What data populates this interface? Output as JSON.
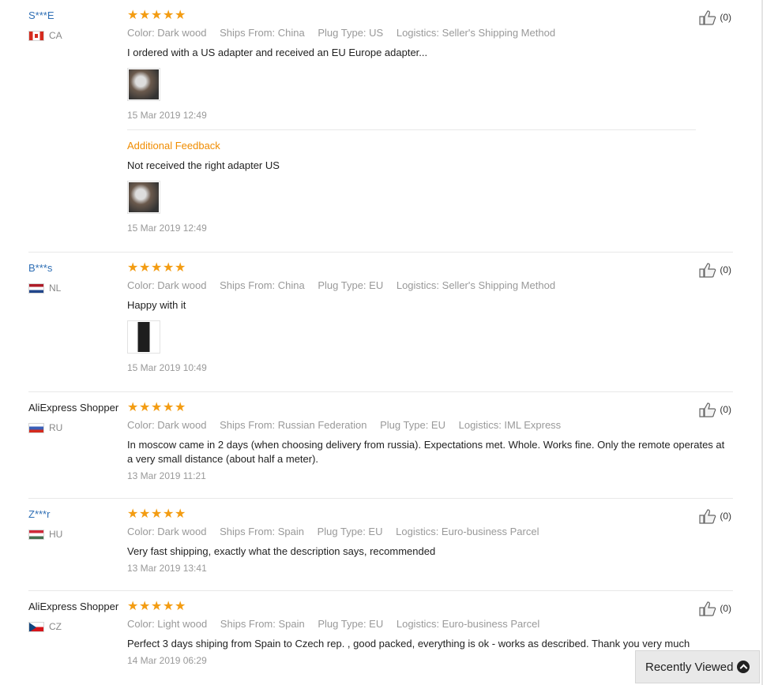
{
  "reviews": [
    {
      "user": "S***E",
      "user_is_link": true,
      "country": "CA",
      "flag": "flag-ca",
      "stars": 5,
      "attrs": [
        "Color: Dark wood",
        "Ships From: China",
        "Plug Type: US",
        "Logistics: Seller's Shipping Method"
      ],
      "text": "I ordered with a US adapter and received an EU Europe adapter...",
      "has_image": true,
      "date": "15 Mar 2019 12:49",
      "additional_title": "Additional Feedback",
      "additional_text": "Not received the right adapter US",
      "additional_date": "15 Mar 2019 12:49",
      "likes": "(0)"
    },
    {
      "user": "B***s",
      "user_is_link": true,
      "country": "NL",
      "flag": "flag-nl",
      "stars": 5,
      "attrs": [
        "Color: Dark wood",
        "Ships From: China",
        "Plug Type: EU",
        "Logistics: Seller's Shipping Method"
      ],
      "text": "Happy with it",
      "has_image": true,
      "date": "15 Mar 2019 10:49",
      "likes": "(0)"
    },
    {
      "user": "AliExpress Shopper",
      "user_is_link": false,
      "country": "RU",
      "flag": "flag-ru",
      "stars": 5,
      "attrs": [
        "Color: Dark wood",
        "Ships From: Russian Federation",
        "Plug Type: EU",
        "Logistics: IML Express"
      ],
      "text": "In moscow came in 2 days (when choosing delivery from russia). Expectations met. Whole. Works fine. Only the remote operates at a very small distance (about half a meter).",
      "has_image": false,
      "date": "13 Mar 2019 11:21",
      "likes": "(0)"
    },
    {
      "user": "Z***r",
      "user_is_link": true,
      "country": "HU",
      "flag": "flag-hu",
      "stars": 5,
      "attrs": [
        "Color: Dark wood",
        "Ships From: Spain",
        "Plug Type: EU",
        "Logistics: Euro-business Parcel"
      ],
      "text": "Very fast shipping, exactly what the description says, recommended",
      "has_image": false,
      "date": "13 Mar 2019 13:41",
      "likes": "(0)"
    },
    {
      "user": "AliExpress Shopper",
      "user_is_link": false,
      "country": "CZ",
      "flag": "flag-cz",
      "stars": 5,
      "attrs": [
        "Color: Light wood",
        "Ships From: Spain",
        "Plug Type: EU",
        "Logistics: Euro-business Parcel"
      ],
      "text": "Perfect 3 days shiping from Spain to Czech rep. , good packed, everything is ok - works as described. Thank you very much",
      "has_image": false,
      "date": "14 Mar 2019 06:29",
      "likes": "(0)"
    }
  ],
  "recently_viewed": {
    "label": "Recently Viewed",
    "icon": "chevron-up-circle-icon"
  },
  "colors": {
    "link": "#2f6fb5",
    "star": "#f39c12",
    "muted": "#999999",
    "additional": "#f08c00"
  }
}
